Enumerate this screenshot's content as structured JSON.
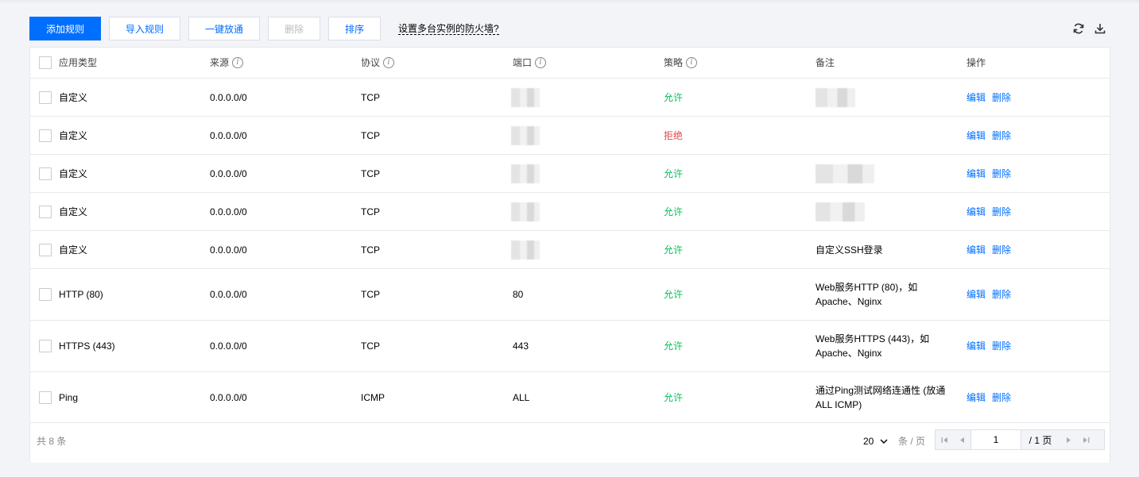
{
  "toolbar": {
    "add_rule": "添加规则",
    "import_rules": "导入规则",
    "one_click_open": "一键放通",
    "delete": "删除",
    "sort": "排序",
    "multi_instance_link": "设置多台实例的防火墙?",
    "refresh_icon": "refresh-icon",
    "download_icon": "download-icon"
  },
  "table": {
    "headers": {
      "app_type": "应用类型",
      "source": "来源",
      "protocol": "协议",
      "port": "端口",
      "policy": "策略",
      "note": "备注",
      "action": "操作"
    },
    "rows": [
      {
        "app_type": "自定义",
        "source": "0.0.0.0/0",
        "protocol": "TCP",
        "port": "",
        "policy": "允许",
        "note": "",
        "edit": "编辑",
        "delete": "删除"
      },
      {
        "app_type": "自定义",
        "source": "0.0.0.0/0",
        "protocol": "TCP",
        "port": "",
        "policy": "拒绝",
        "note": "",
        "edit": "编辑",
        "delete": "删除"
      },
      {
        "app_type": "自定义",
        "source": "0.0.0.0/0",
        "protocol": "TCP",
        "port": "",
        "policy": "允许",
        "note": "",
        "edit": "编辑",
        "delete": "删除"
      },
      {
        "app_type": "自定义",
        "source": "0.0.0.0/0",
        "protocol": "TCP",
        "port": "",
        "policy": "允许",
        "note": "",
        "edit": "编辑",
        "delete": "删除"
      },
      {
        "app_type": "自定义",
        "source": "0.0.0.0/0",
        "protocol": "TCP",
        "port": "",
        "policy": "允许",
        "note": "自定义SSH登录",
        "edit": "编辑",
        "delete": "删除"
      },
      {
        "app_type": "HTTP (80)",
        "source": "0.0.0.0/0",
        "protocol": "TCP",
        "port": "80",
        "policy": "允许",
        "note": "Web服务HTTP (80)，如Apache、Nginx",
        "edit": "编辑",
        "delete": "删除"
      },
      {
        "app_type": "HTTPS (443)",
        "source": "0.0.0.0/0",
        "protocol": "TCP",
        "port": "443",
        "policy": "允许",
        "note": "Web服务HTTPS (443)，如Apache、Nginx",
        "edit": "编辑",
        "delete": "删除"
      },
      {
        "app_type": "Ping",
        "source": "0.0.0.0/0",
        "protocol": "ICMP",
        "port": "ALL",
        "policy": "允许",
        "note": "通过Ping测试网络连通性 (放通ALL ICMP)",
        "edit": "编辑",
        "delete": "删除"
      }
    ]
  },
  "footer": {
    "total": "共 8 条",
    "page_size": "20",
    "page_size_unit": "条 / 页",
    "current_page": "1",
    "total_pages": "/ 1 页"
  },
  "colors": {
    "primary": "#006eff",
    "allow": "#0abf5b",
    "deny": "#e54545"
  }
}
